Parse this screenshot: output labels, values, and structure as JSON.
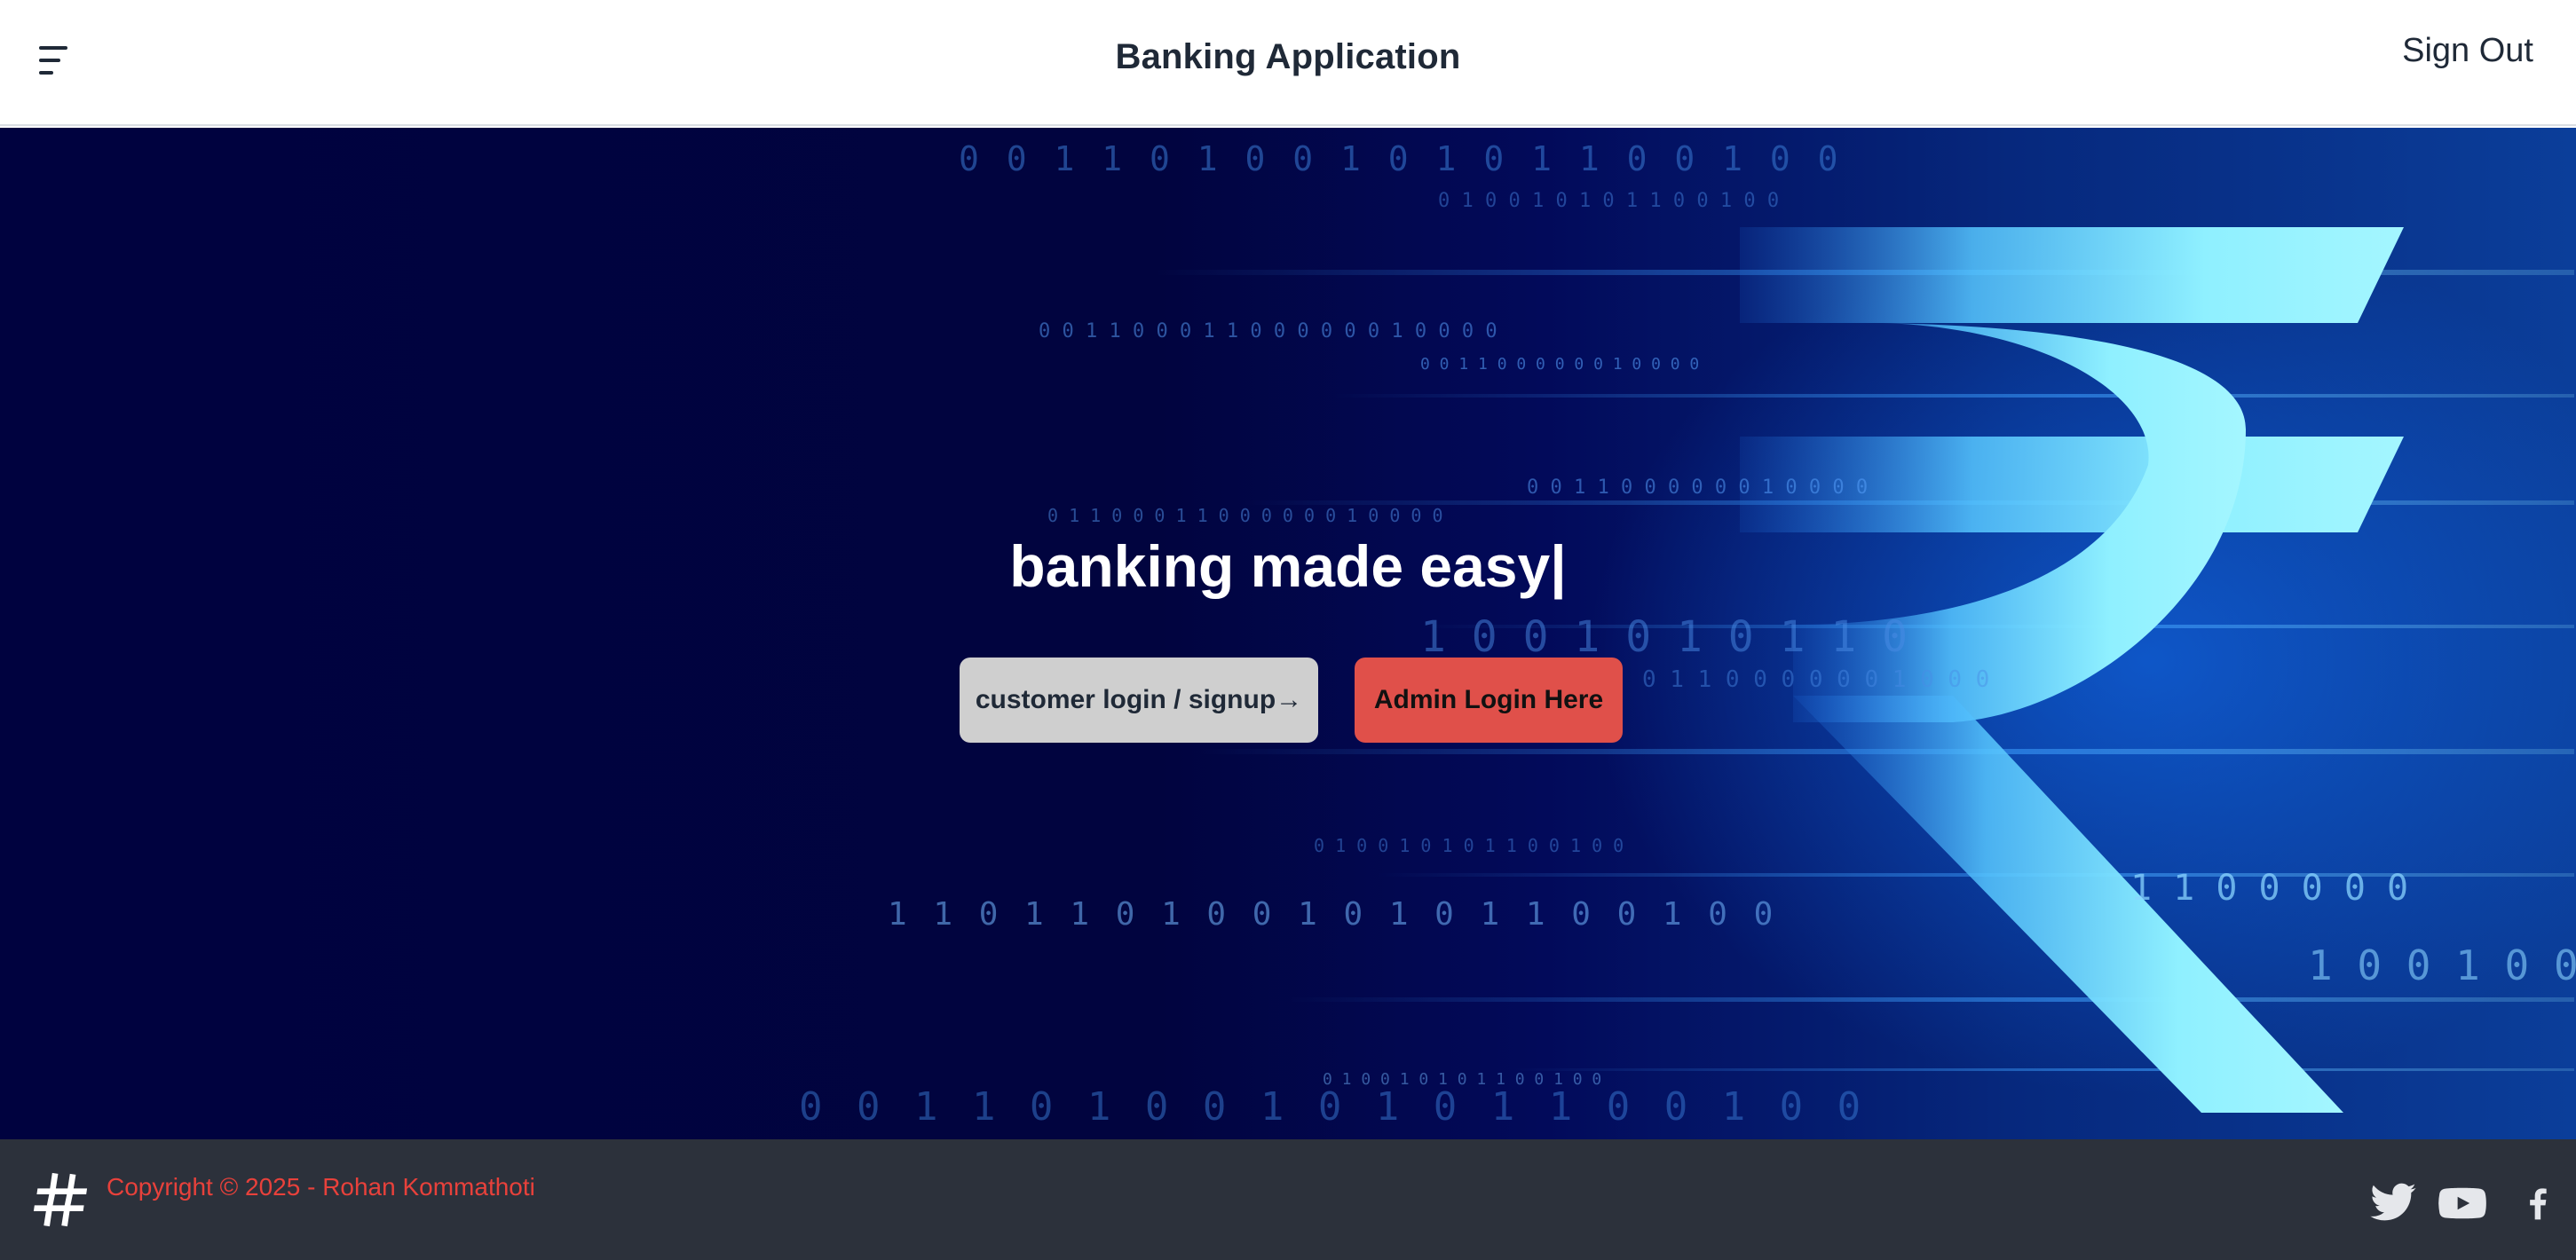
{
  "header": {
    "menu_icon": "hamburger-menu-icon",
    "title": "Banking Application",
    "sign_out_label": "Sign Out"
  },
  "hero": {
    "headline": "banking made easy|",
    "customer_button_label": "customer login / signup→",
    "admin_button_label": "Admin Login Here",
    "background_icon": "rupee-symbol-binary-background",
    "binary_rows": [
      "0 0 1 1 0 1 0 0 1 0 1 0 1 1 0 0 1 0 0",
      "0 1 0 0 1 0 1 0 1 1 0 0 1 0 0",
      "0 0 1 1 0 0 0 1 1 0 0 0 0 0 0 1 0 0 0 0",
      "0 0 1 1 0 0 0 0 0 0 1 0 0 0 0",
      "0 1 1 0 0 0 1 1 0 0 0 0 0 0 1 0 0 0 0",
      "0 0 1 1 0 0 0 0 0 0 1 0 0 0 0",
      "1 0 0 1 0 1 0 1 1 0",
      "0 1 1 0 0 0 0 0 0 1 0 0 0",
      "0 1 0 0 1 0 1 0 1 1 0 0 1 0 0",
      "1 1 0 1 1 0 1 0 0 1 0 1 0 1 1 0 0 1 0 0",
      "0 1 0 0 1 0 1 0 1 1 0 0 1 0 0",
      "0 0 1 1 0 1 0 0 1 0 1 0 1 1 0 0 1 0 0",
      "1 1 0 0 0 0 0",
      "1 0 0 1 0 0"
    ]
  },
  "footer": {
    "logo_icon": "hashtag-icon",
    "copyright": "Copyright © 2025 - Rohan Kommathoti",
    "social": [
      {
        "name": "twitter-icon"
      },
      {
        "name": "youtube-icon"
      },
      {
        "name": "facebook-icon"
      }
    ]
  },
  "colors": {
    "hero_dark": "#00023f",
    "hero_glow": "#1478ff",
    "rupee": "#8ff0ff",
    "admin_button": "#e0504a",
    "customer_button": "#cfcfcf",
    "footer_bg": "#2c313b",
    "copyright_text": "#e8413b"
  }
}
